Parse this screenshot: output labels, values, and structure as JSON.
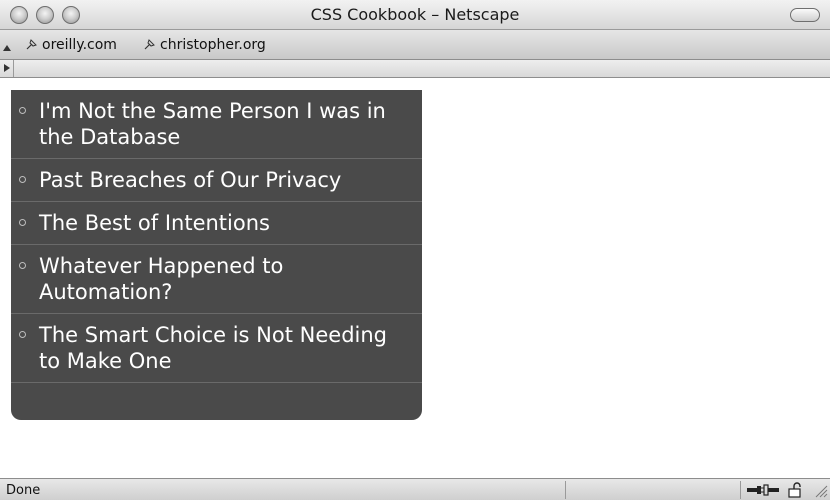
{
  "window": {
    "title": "CSS Cookbook – Netscape"
  },
  "bookmarks_bar": {
    "items": [
      {
        "label": "oreilly.com",
        "icon": "bookmark-pin-icon"
      },
      {
        "label": "christopher.org",
        "icon": "bookmark-pin-icon"
      }
    ]
  },
  "nav": {
    "background": "#4a4a4a",
    "text_color": "#ffffff",
    "items": [
      {
        "label": "I'm Not the Same Person I was in the Database"
      },
      {
        "label": "Past Breaches of Our Privacy"
      },
      {
        "label": "The Best of Intentions"
      },
      {
        "label": "Whatever Happened to Automation?"
      },
      {
        "label": "The Smart Choice is Not Needing to Make One"
      }
    ]
  },
  "status_bar": {
    "text": "Done",
    "icons": [
      "connection-icon",
      "lock-icon",
      "resize-grip-icon"
    ]
  }
}
